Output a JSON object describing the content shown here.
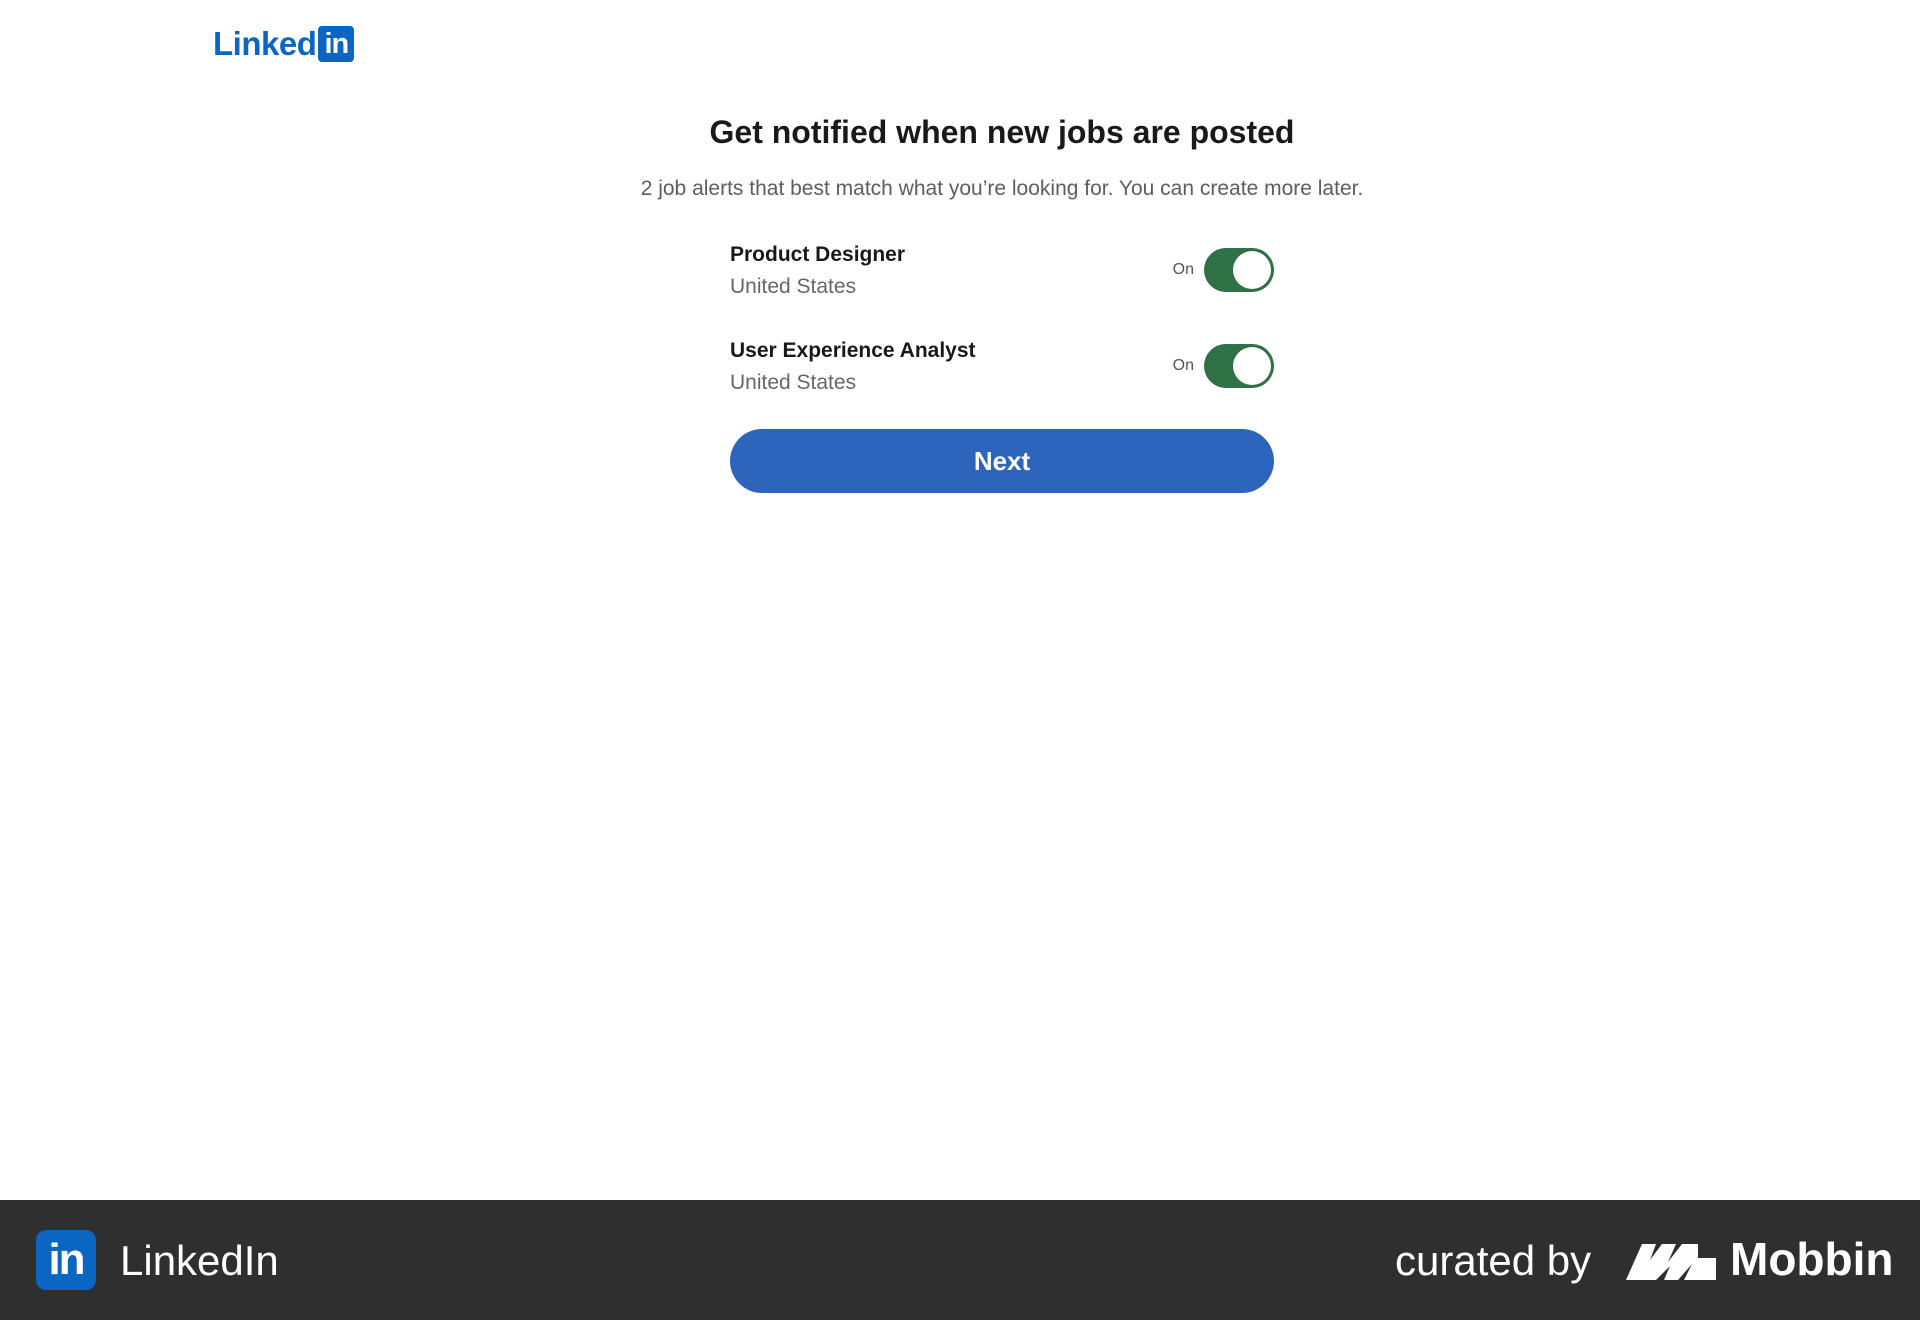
{
  "header": {
    "logo": {
      "word": "Linked",
      "box": "in"
    }
  },
  "main": {
    "title": "Get notified when new jobs are posted",
    "subtitle": "2 job alerts that best match what you’re looking for. You can create more later.",
    "alerts": [
      {
        "title": "Product Designer",
        "location": "United States",
        "toggle_label": "On",
        "enabled": true
      },
      {
        "title": "User Experience Analyst",
        "location": "United States",
        "toggle_label": "On",
        "enabled": true
      }
    ],
    "next_label": "Next"
  },
  "footer": {
    "app_icon": "in",
    "app_name": "LinkedIn",
    "curated_by": "curated by",
    "brand": "Mobbin"
  },
  "colors": {
    "linkedin_blue": "#0a66c2",
    "button_blue": "#2d64bc",
    "toggle_green": "#2e7144",
    "footer_bg": "#2f2f2f"
  },
  "icons": {
    "logo": "linkedin-logo",
    "footer_app": "linkedin-app-icon",
    "footer_brand": "mobbin-logo-icon"
  }
}
